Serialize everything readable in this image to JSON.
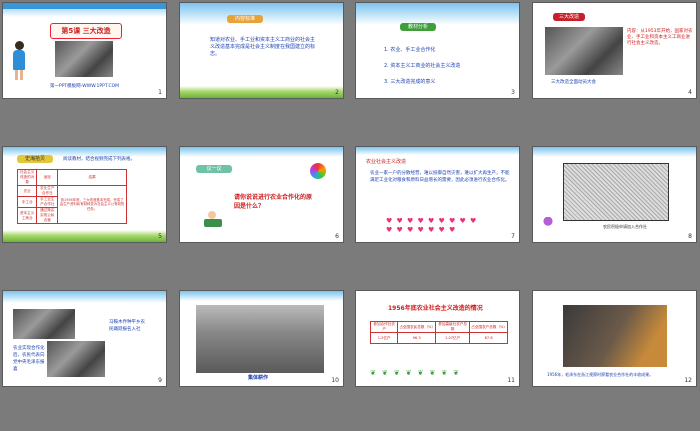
{
  "slides": [
    {
      "number": "1",
      "title": "第5课 三大改造",
      "footer": "第一PPT模板网-WWW.1PPT.COM"
    },
    {
      "number": "2",
      "heading": "内容标准",
      "body": "知道对农业、手工业和资本主义工商业的社会主义改造基本完成是社会主义制度在我国建立的标志。"
    },
    {
      "number": "3",
      "heading": "教材分析",
      "items": [
        "1. 农业、手工业合作化",
        "2. 资本主义工商业的社会主义改造",
        "3. 三大改造完成的意义"
      ]
    },
    {
      "number": "4",
      "heading": "三大改造",
      "body": "内容：从1953年开始，国家对农业、手工业和资本主义工商业进行社会主义改造。",
      "caption": "三大改造全面动员大会"
    },
    {
      "number": "5",
      "heading": "史海拾贝",
      "intro": "阅读教材，结合视频完成下列表格。",
      "table": [
        [
          "社会主义改造的对象",
          "途径",
          "结果"
        ],
        [
          "农业",
          "农业生产合作社",
          ""
        ],
        [
          "手工业",
          "手工业生产合作社",
          ""
        ],
        [
          "资本主义工商业",
          "通过赎买实现公私合营",
          ""
        ]
      ],
      "result": "到1956年底，三大改造基本完成。完成了由生产资料私有制转变为社会主义公有制的任务。"
    },
    {
      "number": "6",
      "heading": "议一议",
      "question": "请你说说进行农业合作化的原因是什么？"
    },
    {
      "number": "7",
      "heading": "农业社会主义改造",
      "body": "农业一家一户的分散经营，难以抵御自然灾害，难以扩大再生产，不能满足工业化对粮食和原料日益增长的需要，因此必须进行农业合作化。"
    },
    {
      "number": "8",
      "caption": "农民积极申请加入合作社"
    },
    {
      "number": "9",
      "caption1": "马鞍木乔种平乡农民踊跃报名入社",
      "caption2": "农业实现合作化后，农民代表向党中央毛泽东报喜"
    },
    {
      "number": "10",
      "caption": "集体耕作"
    },
    {
      "number": "11",
      "title": "1956年底农业社会主义改造的情况",
      "headers": [
        "参加合作社农户",
        "占全国农民总数（%）",
        "参加高级社农户总数",
        "占全国农户总数（%）"
      ],
      "values": [
        "1.2亿户",
        "96.3",
        "1.07亿户",
        "87.8"
      ]
    },
    {
      "number": "12",
      "caption": "1956年，毛泽东在浙江视察时察看农业合作社的丰收成果。"
    }
  ],
  "colors": {
    "title_red": "#d01f1f",
    "blue": "#1a3fae",
    "red_text": "#cc1d1d",
    "sky": "#7cc3ee",
    "grass": "#6ab43a"
  }
}
